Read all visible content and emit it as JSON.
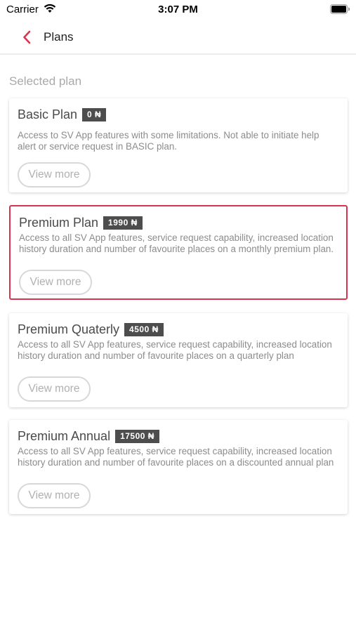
{
  "status": {
    "carrier": "Carrier",
    "time": "3:07 PM"
  },
  "nav": {
    "title": "Plans"
  },
  "section_label": "Selected plan",
  "accent_color": "#d9344f",
  "plans": [
    {
      "name": "Basic Plan",
      "price": "0 ₦",
      "description": "Access to SV App features with some limitations. Not able to initiate help alert or service request in BASIC plan.",
      "more_label": "View more",
      "selected": false
    },
    {
      "name": "Premium Plan",
      "price": "1990 ₦",
      "description": "Access to all SV App features, service request capability, increased location history duration and number of favourite places on a monthly premium plan.",
      "more_label": "View more",
      "selected": true
    },
    {
      "name": "Premium Quaterly",
      "price": "4500 ₦",
      "description": "Access to all SV App features, service request capability, increased location history duration and number of favourite places on a quarterly plan",
      "more_label": "View more",
      "selected": false
    },
    {
      "name": "Premium Annual",
      "price": "17500 ₦",
      "description": "Access to all SV App features, service request capability, increased location history duration and number of favourite places on a discounted annual plan",
      "more_label": "View more",
      "selected": false
    }
  ]
}
